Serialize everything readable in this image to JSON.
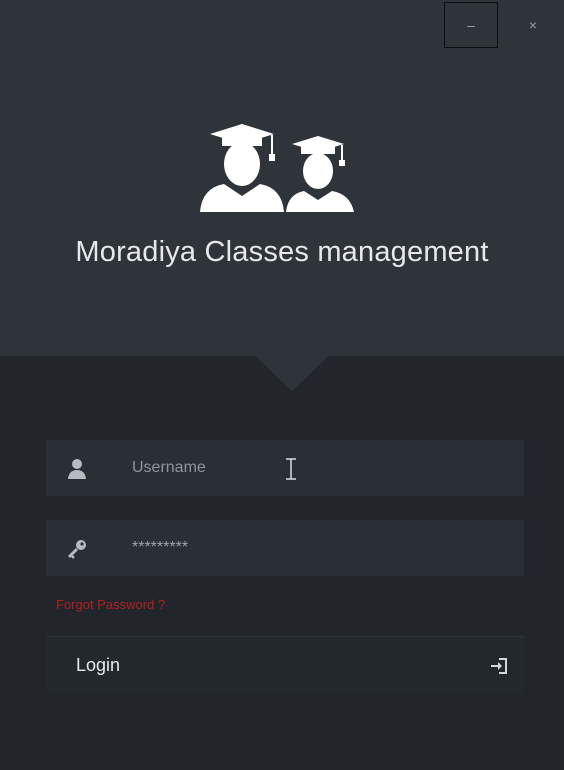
{
  "window": {
    "minimize_symbol": "–",
    "close_symbol": "×"
  },
  "header": {
    "logo_icon": "graduates-icon",
    "app_title": "Moradiya Classes management"
  },
  "form": {
    "username": {
      "placeholder": "Username",
      "value": "",
      "icon": "user-icon"
    },
    "password": {
      "placeholder": "",
      "value": "*********",
      "icon": "key-icon"
    },
    "forgot_password_label": "Forgot Password ?",
    "login_label": "Login",
    "login_icon": "sign-in-icon"
  },
  "colors": {
    "top_panel": "#2f343a",
    "bottom_panel": "#22262b",
    "field_bg": "#2a2f35",
    "forgot_link": "#b01e22",
    "title_text": "#e6e8ea"
  }
}
